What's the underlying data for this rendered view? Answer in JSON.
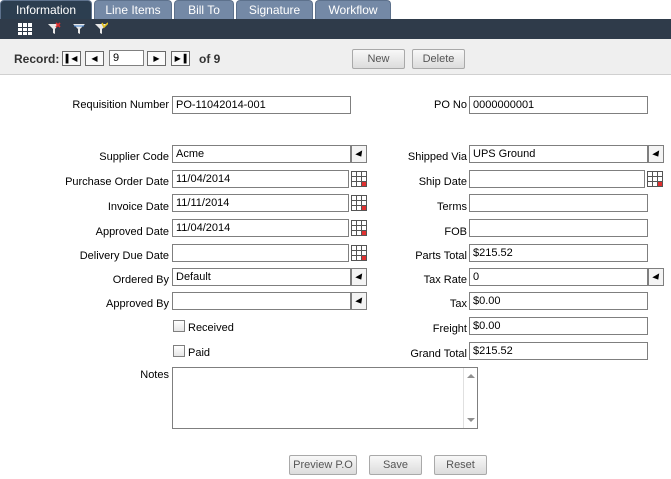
{
  "tabs": [
    "Information",
    "Line Items",
    "Bill To",
    "Signature",
    "Workflow"
  ],
  "toolbar": {
    "icons": [
      "grid-icon",
      "filter-clear-icon",
      "filter-icon",
      "filter-apply-icon"
    ]
  },
  "record": {
    "label": "Record:",
    "current": "9",
    "of_label": "of 9",
    "new_label": "New",
    "delete_label": "Delete"
  },
  "form": {
    "requisition_number": {
      "label": "Requisition Number",
      "value": "PO-11042014-001"
    },
    "po_no": {
      "label": "PO No",
      "value": "0000000001"
    },
    "supplier_code": {
      "label": "Supplier Code",
      "value": "Acme"
    },
    "shipped_via": {
      "label": "Shipped Via",
      "value": "UPS Ground"
    },
    "purchase_order_date": {
      "label": "Purchase Order Date",
      "value": "11/04/2014"
    },
    "ship_date": {
      "label": "Ship Date",
      "value": ""
    },
    "invoice_date": {
      "label": "Invoice Date",
      "value": "11/11/2014"
    },
    "terms": {
      "label": "Terms",
      "value": ""
    },
    "approved_date": {
      "label": "Approved Date",
      "value": "11/04/2014"
    },
    "fob": {
      "label": "FOB",
      "value": ""
    },
    "delivery_due_date": {
      "label": "Delivery Due Date",
      "value": ""
    },
    "parts_total": {
      "label": "Parts Total",
      "value": "$215.52"
    },
    "ordered_by": {
      "label": "Ordered By",
      "value": "Default"
    },
    "tax_rate": {
      "label": "Tax Rate",
      "value": "0"
    },
    "approved_by": {
      "label": "Approved By",
      "value": ""
    },
    "tax": {
      "label": "Tax",
      "value": "$0.00"
    },
    "received": {
      "label": "Received"
    },
    "freight": {
      "label": "Freight",
      "value": "$0.00"
    },
    "paid": {
      "label": "Paid"
    },
    "grand_total": {
      "label": "Grand Total",
      "value": "$215.52"
    },
    "notes": {
      "label": "Notes",
      "value": ""
    }
  },
  "actions": {
    "preview_label": "Preview P.O",
    "save_label": "Save",
    "reset_label": "Reset"
  }
}
